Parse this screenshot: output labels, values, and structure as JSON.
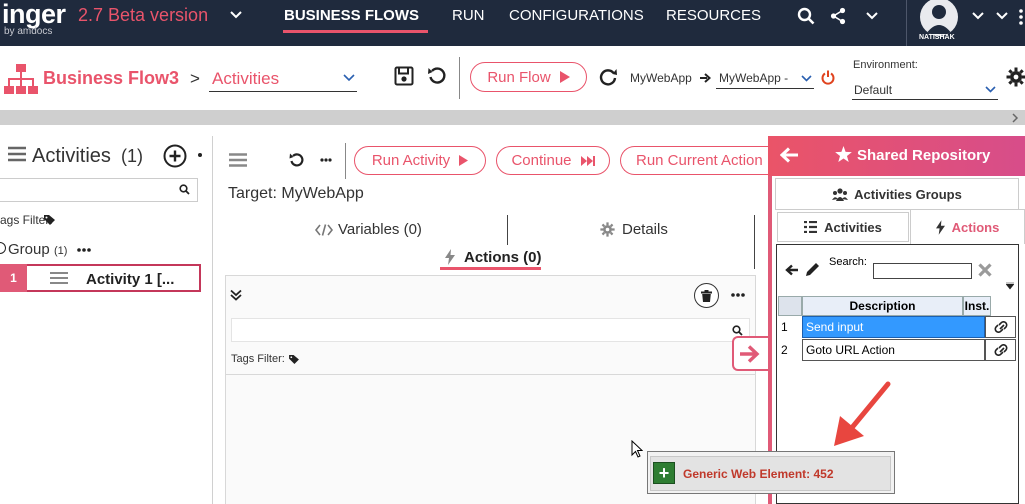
{
  "app": {
    "logo_text": "inger",
    "logo_sub": "by amdocs",
    "version": "2.7 Beta version"
  },
  "nav": {
    "items": [
      "BUSINESS FLOWS",
      "RUN",
      "CONFIGURATIONS",
      "RESOURCES"
    ],
    "active": "BUSINESS FLOWS",
    "user": "NATISHAK"
  },
  "flowbar": {
    "flow_name": "Business Flow3",
    "separator": ">",
    "page": "Activities",
    "run_flow": "Run Flow",
    "target_app_a": "MyWebApp",
    "target_app_b": "MyWebApp -",
    "environment_label": "Environment:",
    "environment_value": "Default"
  },
  "left": {
    "title": "Activities",
    "count": "(1)",
    "tags_filter": "ags Filter:",
    "group_label": "Group",
    "group_count": "(1)",
    "activity_num": "1",
    "activity_name": "Activity 1 [..."
  },
  "middle": {
    "run_activity": "Run Activity",
    "continue": "Continue",
    "run_current": "Run Current Action",
    "target": "Target: MyWebApp",
    "tab_variables": "Variables (0)",
    "tab_details": "Details",
    "tab_actions": "Actions (0)",
    "tags_filter": "Tags Filter:"
  },
  "repo": {
    "title": "Shared Repository",
    "tab_groups": "Activities Groups",
    "tab_activities": "Activities",
    "tab_actions": "Actions",
    "search_label": "Search:",
    "columns": [
      "Description",
      "Inst."
    ],
    "rows": [
      {
        "num": "1",
        "description": "Send input",
        "selected": true
      },
      {
        "num": "2",
        "description": "Goto URL Action",
        "selected": false
      }
    ]
  },
  "drag": {
    "text": "Generic Web Element: 452"
  },
  "colors": {
    "accent": "#e9546b",
    "nav_bg": "#1f2a3d",
    "selection": "#3399ff"
  }
}
